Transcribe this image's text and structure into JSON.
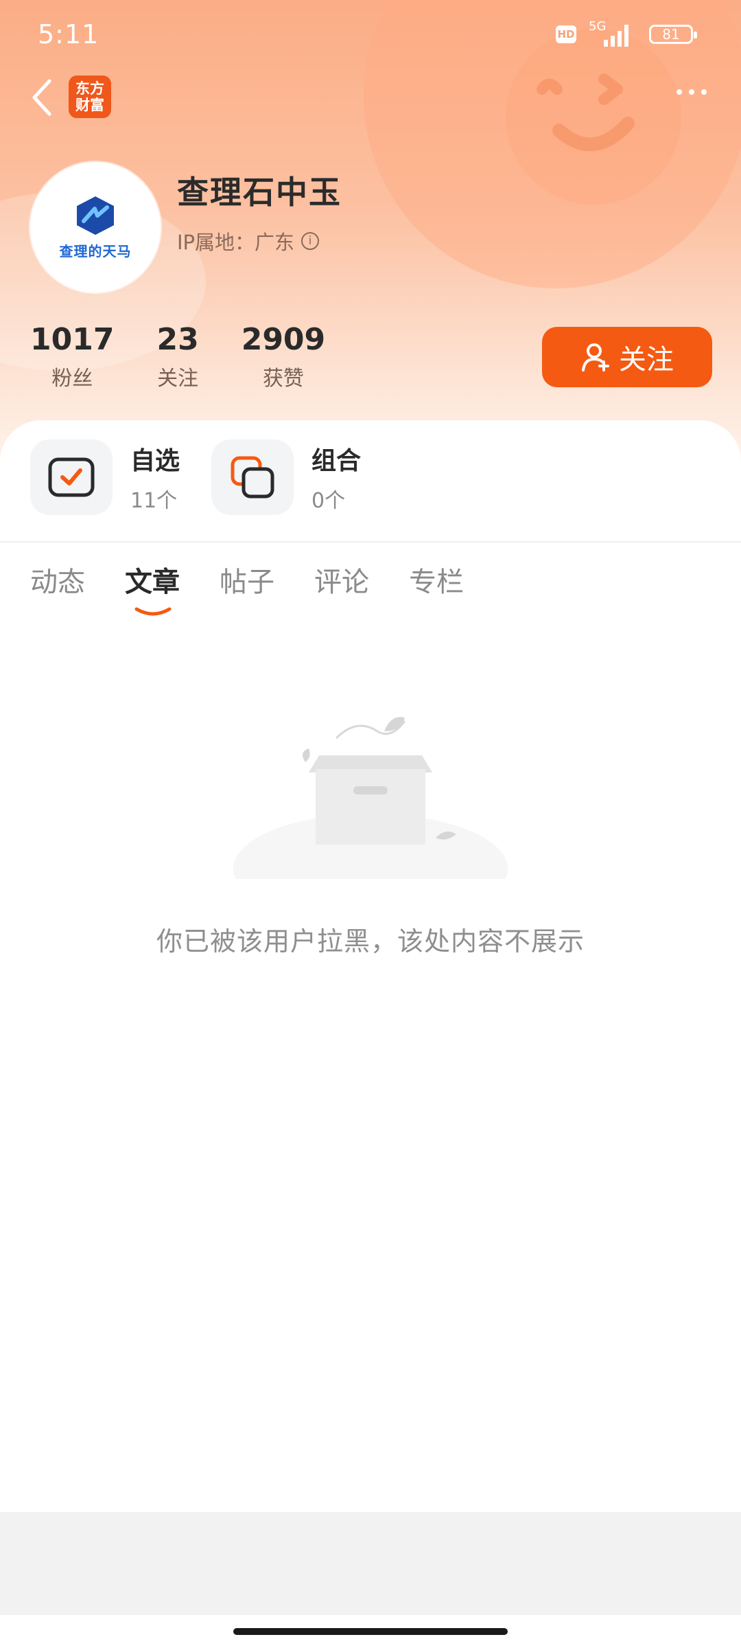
{
  "status_bar": {
    "time": "5:11",
    "hd": "HD",
    "network": "5G",
    "battery": "81"
  },
  "nav": {
    "app_logo_line1": "东方",
    "app_logo_line2": "财富"
  },
  "profile": {
    "avatar_text": "查理的天马",
    "username": "查理石中玉",
    "ip_location": "IP属地：广东",
    "follow_label": "关注"
  },
  "stats": [
    {
      "value": "1017",
      "label": "粉丝"
    },
    {
      "value": "23",
      "label": "关注"
    },
    {
      "value": "2909",
      "label": "获赞"
    }
  ],
  "quick_entries": [
    {
      "title": "自选",
      "sub": "11个",
      "icon": "watchlist-check-icon"
    },
    {
      "title": "组合",
      "sub": "0个",
      "icon": "portfolio-squares-icon"
    }
  ],
  "tabs": [
    {
      "label": "动态"
    },
    {
      "label": "文章",
      "active": true
    },
    {
      "label": "帖子"
    },
    {
      "label": "评论"
    },
    {
      "label": "专栏"
    }
  ],
  "empty_state": {
    "message": "你已被该用户拉黑，该处内容不展示"
  },
  "colors": {
    "accent": "#f55a12",
    "hero_top": "#fbad85"
  }
}
